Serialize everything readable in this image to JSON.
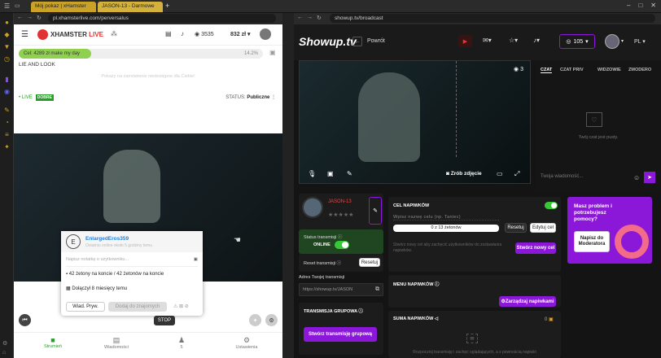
{
  "browser": {
    "tab1": "Mój pokaz | xHamster",
    "tab2": "JASON-13 - Darmowe",
    "new_tab": "+",
    "left_url": "pl.xhamsterlive.com/perversalus",
    "right_url": "showup.tv/broadcast",
    "window_controls": [
      "–",
      "□",
      "✕"
    ]
  },
  "xh": {
    "brand": "XHAMSTER",
    "brand2": "LIVE",
    "tokens": "3535",
    "balance": "832 zł",
    "goal_label": "Cel: 4289 zł make my day",
    "goal_pct": "14.2%",
    "goal_fill": 0.142,
    "topic": "LIE AND LOOK",
    "notice": "Pokazy na zamówienie niedostępne dla Ciebie!",
    "live": "• LIVE",
    "good": "DOBRE",
    "status_label": "STATUS:",
    "status_value": "Publiczne",
    "popup": {
      "avatar": "E",
      "user": "EnlargedEros359",
      "sub": "Ostatnio online około 5 godziny temu",
      "input": "Napisz notatkę o użytkowniku...",
      "tokens_line": "42 żetony na koncie / 42 żetonów na koncie",
      "joined": "Dołączył 8 miesięcy temu",
      "btn_pm": "Wiad. Pryw.",
      "btn_add": "Dodaj do znajomych"
    },
    "stop": "STOP",
    "nav": [
      {
        "icon": "camera-icon",
        "label": "Strumień"
      },
      {
        "icon": "chat-icon",
        "label": "Wiadomości"
      },
      {
        "icon": "user-icon",
        "label": "5"
      },
      {
        "icon": "gear-icon",
        "label": "Ustawienia"
      }
    ]
  },
  "su": {
    "logo": "Showup.tv",
    "back": "Powrót",
    "coins": "105",
    "lang": "PL",
    "viewers": "3",
    "snapshot": "Zrób zdjęcie",
    "tabs": [
      "CZAT",
      "CZAT PRIV",
      "WIDZOWIE",
      "ZMODERO"
    ],
    "chat_empty": "Twój czat jest pusty.",
    "chat_placeholder": "Twoja wiadomość...",
    "user": "JASON-13",
    "stars": "★★★★★",
    "status_label": "Status transmisji",
    "status_online": "ONLINE",
    "reset_label": "Reset transmisji",
    "reset_btn": "Resetuj",
    "addr_label": "Adres Twojej transmisji",
    "addr_value": "https://showup.tv/JASON",
    "group_label": "TRANSMISJA GRUPOWA",
    "group_btn": "Stwórz transmisję grupową",
    "goal_title": "CEL NAPIWKÓW",
    "goal_placeholder": "Wpisz nazwę celu (np. Taniec)",
    "goal_progress": "0 z 13 żetonów",
    "goal_reset": "Resetuj",
    "goal_edit": "Edytuj cel",
    "goal_desc": "Stwórz nowy cel aby zachęcić użytkowników do zostawiania napiwków.",
    "goal_new": "Stwórz nowy cel",
    "menu_title": "MENU NAPIWKÓW",
    "menu_btn": "Zarządzaj napiwkami",
    "sum_title": "SUMA NAPIWKÓW",
    "sum_value": "0",
    "sum_desc": "Rozpocznij transmisję i zachęć oglądających, a z pewnością napiwki",
    "promo_title": "Masz problem i potrzebujesz pomocy?",
    "promo_btn": "Napisz do Moderatora"
  }
}
